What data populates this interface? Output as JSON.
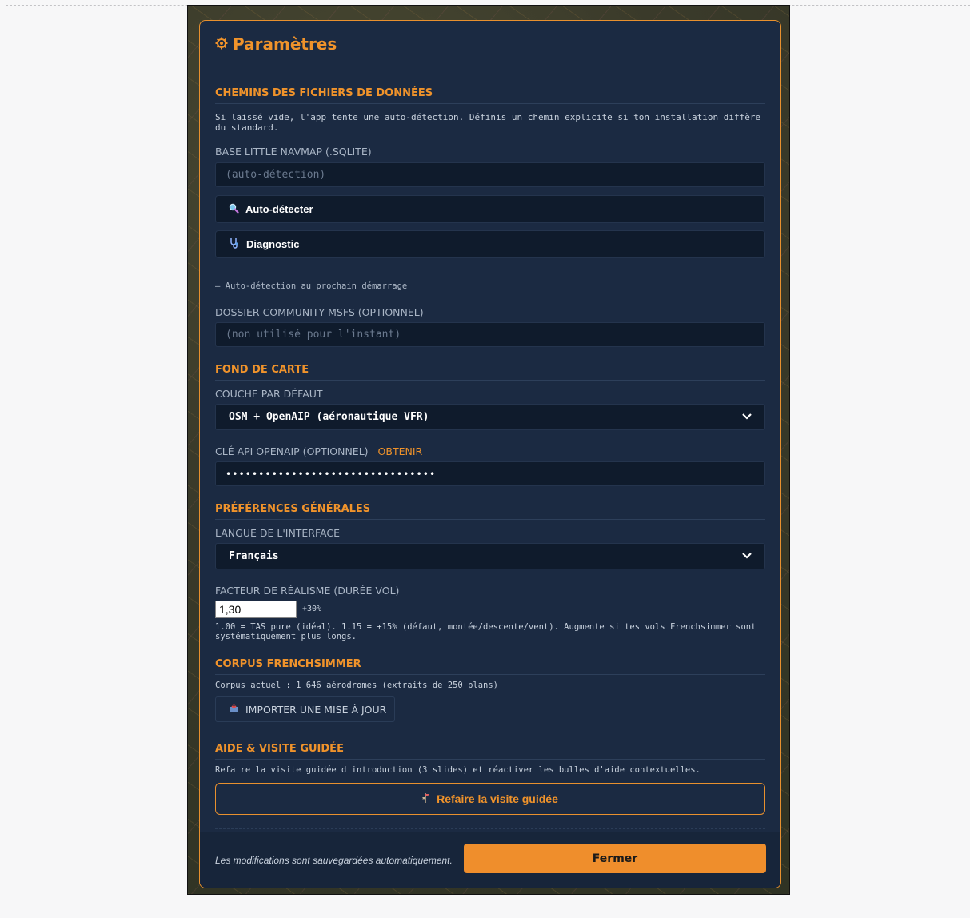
{
  "modal": {
    "title": "Paramètres",
    "title_icon": "gear-icon"
  },
  "sections": {
    "paths": {
      "title": "CHEMINS DES FICHIERS DE DONNÉES",
      "note": "Si laissé vide, l'app tente une auto-détection. Définis un chemin explicite si ton installation diffère du standard.",
      "lnm_label": "BASE LITTLE NAVMAP (.SQLITE)",
      "lnm_placeholder": "(auto-détection)",
      "autodetect_label": "Auto-détecter",
      "diagnostic_label": "Diagnostic",
      "status_note": "— Auto-détection au prochain démarrage",
      "community_label": "DOSSIER COMMUNITY MSFS (OPTIONNEL)",
      "community_placeholder": "(non utilisé pour l'instant)"
    },
    "basemap": {
      "title": "FOND DE CARTE",
      "layer_label": "COUCHE PAR DÉFAUT",
      "layer_value": "OSM + OpenAIP (aéronautique VFR)",
      "api_label": "CLÉ API OPENAIP (OPTIONNEL)",
      "api_link": "OBTENIR",
      "api_value": "••••••••••••••••••••••••••••••••"
    },
    "general": {
      "title": "PRÉFÉRENCES GÉNÉRALES",
      "lang_label": "LANGUE DE L'INTERFACE",
      "lang_value": "Français",
      "realism_label": "FACTEUR DE RÉALISME (DURÉE VOL)",
      "realism_value": "1,30",
      "realism_pct": "+30%",
      "realism_note": "1.00 = TAS pure (idéal). 1.15 = +15% (défaut, montée/descente/vent). Augmente si tes vols Frenchsimmer sont systématiquement plus longs."
    },
    "corpus": {
      "title": "CORPUS FRENCHSIMMER",
      "note": "Corpus actuel : 1 646 aérodromes (extraits de 250 plans)",
      "import_label": "IMPORTER UNE MISE À JOUR"
    },
    "help": {
      "title": "AIDE & VISITE GUIDÉE",
      "note": "Refaire la visite guidée d'introduction (3 slides) et réactiver les bulles d'aide contextuelles.",
      "tour_label": "Refaire la visite guidée"
    }
  },
  "footer": {
    "note": "Les modifications sont sauvegardées automatiquement.",
    "close_label": "Fermer"
  },
  "colors": {
    "accent": "#f0932b",
    "panel": "#1b2a42",
    "input_bg": "#0f1b2c"
  }
}
